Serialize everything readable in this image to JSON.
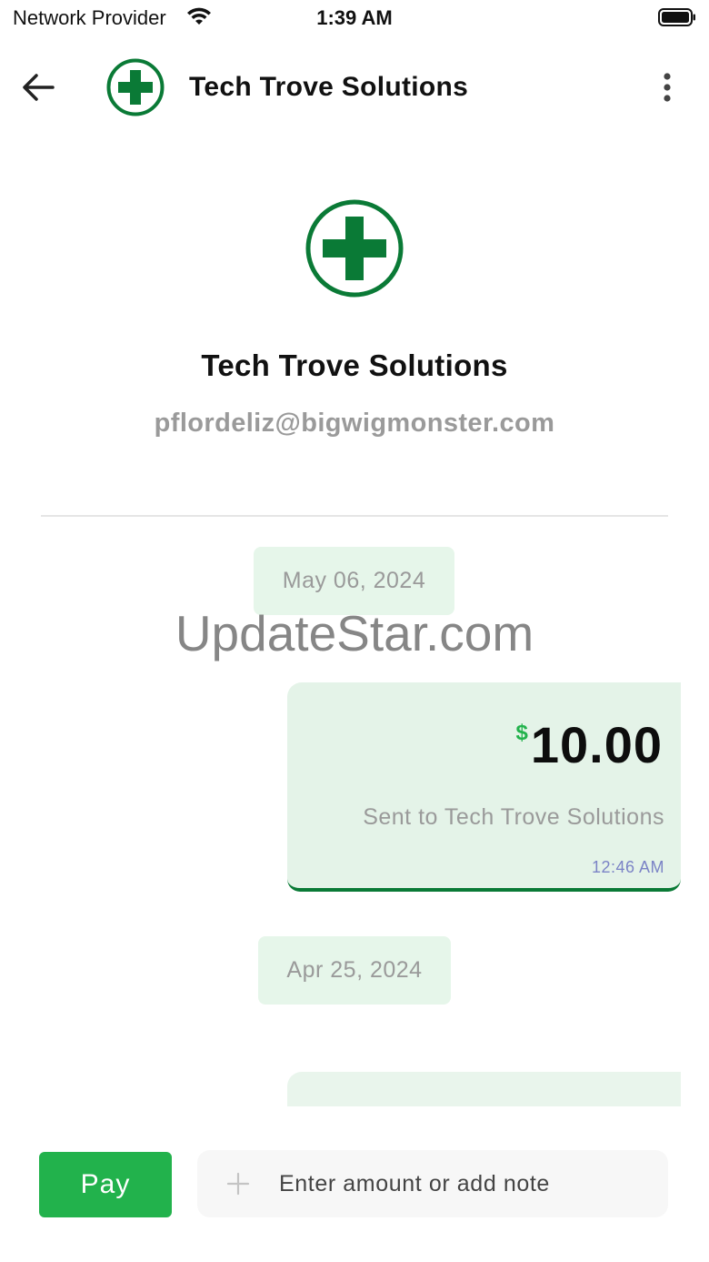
{
  "status_bar": {
    "provider": "Network Provider",
    "time": "1:39 AM",
    "wifi_icon": "wifi-icon",
    "battery_icon": "battery-full-icon"
  },
  "header": {
    "title": "Tech Trove Solutions",
    "back_icon": "arrow-left-icon",
    "menu_icon": "more-vertical-icon",
    "logo_icon": "green-cross-logo"
  },
  "profile": {
    "name": "Tech Trove Solutions",
    "email": "pflordeliz@bigwigmonster.com"
  },
  "watermark": "UpdateStar.com",
  "conversation": [
    {
      "date": "May 06, 2024",
      "transaction": {
        "currency": "$",
        "amount": "10.00",
        "note": "Sent to Tech Trove Solutions",
        "time": "12:46 AM"
      }
    },
    {
      "date": "Apr 25, 2024"
    }
  ],
  "compose": {
    "pay_label": "Pay",
    "placeholder": "Enter amount or add note",
    "add_icon": "plus-icon"
  },
  "colors": {
    "brand_green": "#0a7a36",
    "button_green": "#22b24c",
    "chip_bg": "#e6f6ea",
    "card_bg": "#e4f3e8",
    "time_text": "#7b83c6"
  }
}
